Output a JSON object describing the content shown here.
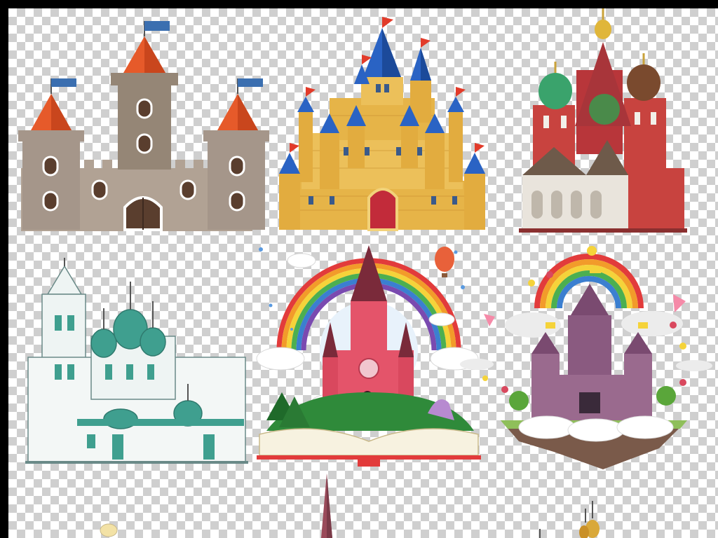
{
  "canvas": {
    "background": "transparent-checkerboard",
    "frame_color": "#000000"
  },
  "illustrations": [
    {
      "name": "brown-stone-castle",
      "colors": {
        "walls": "#a99a8c",
        "roofs": "#e0582a",
        "flags": "#3b6fb0"
      }
    },
    {
      "name": "golden-fairytale-castle",
      "colors": {
        "walls": "#e8b94a",
        "roofs": "#2a63c4",
        "flags": "#e23b2a"
      }
    },
    {
      "name": "st-basils-cathedral",
      "colors": {
        "walls": "#c8433f",
        "domes": "#3aa36c",
        "base": "#e9e4dc"
      }
    },
    {
      "name": "white-orthodox-church",
      "colors": {
        "walls": "#eef4f3",
        "domes": "#3f9f8f"
      }
    },
    {
      "name": "storybook-rainbow-castle",
      "colors": {
        "castle": "#e4546a",
        "grass": "#2f8a3a",
        "book": "#e23b3b"
      }
    },
    {
      "name": "floating-island-castle",
      "colors": {
        "castle": "#9a6a8e",
        "island": "#7a5a4a",
        "clouds": "#ffffff"
      }
    },
    {
      "name": "partial-church-spire",
      "colors": {
        "spire": "#9a4a5a"
      }
    },
    {
      "name": "partial-golden-domes",
      "colors": {
        "domes": "#d9a83a"
      }
    }
  ]
}
